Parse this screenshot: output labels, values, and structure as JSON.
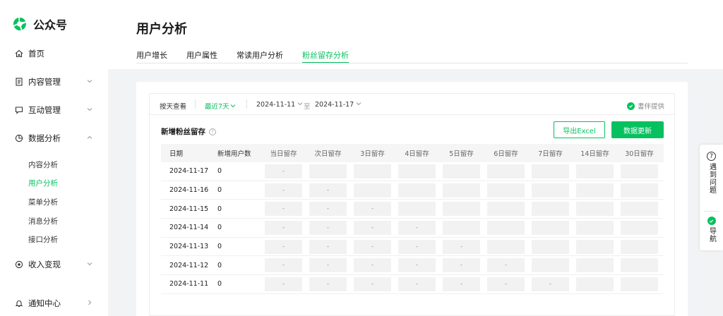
{
  "brand": {
    "name": "公众号"
  },
  "sidebar": {
    "items": [
      {
        "label": "首页",
        "icon": "home-icon"
      },
      {
        "label": "内容管理",
        "icon": "document-icon"
      },
      {
        "label": "互动管理",
        "icon": "chat-icon"
      },
      {
        "label": "数据分析",
        "icon": "chart-icon"
      },
      {
        "label": "收入变现",
        "icon": "money-icon"
      },
      {
        "label": "通知中心",
        "icon": "bell-icon"
      }
    ],
    "sub_items": [
      {
        "label": "内容分析"
      },
      {
        "label": "用户分析",
        "active": true
      },
      {
        "label": "菜单分析"
      },
      {
        "label": "消息分析"
      },
      {
        "label": "接口分析"
      }
    ]
  },
  "page": {
    "title": "用户分析",
    "tabs": [
      "用户增长",
      "用户属性",
      "常读用户分析",
      "粉丝留存分析"
    ],
    "active_tab": 3
  },
  "filter": {
    "by_day": "按天查看",
    "recent": "最近7天",
    "date_start": "2024-11-11",
    "to": "至",
    "date_end": "2024-11-17",
    "provider": "書伴提供"
  },
  "section": {
    "title": "新增粉丝留存",
    "export_label": "导出Excel",
    "refresh_label": "数据更新"
  },
  "table": {
    "columns": [
      "日期",
      "新增用户数",
      "当日留存",
      "次日留存",
      "3日留存",
      "4日留存",
      "5日留存",
      "6日留存",
      "7日留存",
      "14日留存",
      "30日留存"
    ],
    "rows": [
      {
        "date": "2024-11-17",
        "new": "0",
        "cells": [
          "-",
          "",
          "",
          "",
          "",
          "",
          "",
          "",
          ""
        ]
      },
      {
        "date": "2024-11-16",
        "new": "0",
        "cells": [
          "-",
          "-",
          "",
          "",
          "",
          "",
          "",
          "",
          ""
        ]
      },
      {
        "date": "2024-11-15",
        "new": "0",
        "cells": [
          "-",
          "-",
          "-",
          "",
          "",
          "",
          "",
          "",
          ""
        ]
      },
      {
        "date": "2024-11-14",
        "new": "0",
        "cells": [
          "-",
          "-",
          "-",
          "-",
          "",
          "",
          "",
          "",
          ""
        ]
      },
      {
        "date": "2024-11-13",
        "new": "0",
        "cells": [
          "-",
          "-",
          "-",
          "-",
          "-",
          "",
          "",
          "",
          ""
        ]
      },
      {
        "date": "2024-11-12",
        "new": "0",
        "cells": [
          "-",
          "-",
          "-",
          "-",
          "-",
          "-",
          "",
          "",
          ""
        ]
      },
      {
        "date": "2024-11-11",
        "new": "0",
        "cells": [
          "-",
          "-",
          "-",
          "-",
          "-",
          "-",
          "-",
          "",
          ""
        ]
      }
    ]
  },
  "float": {
    "problem": "遇到问题",
    "nav": "导航"
  },
  "colors": {
    "accent": "#07c160"
  }
}
